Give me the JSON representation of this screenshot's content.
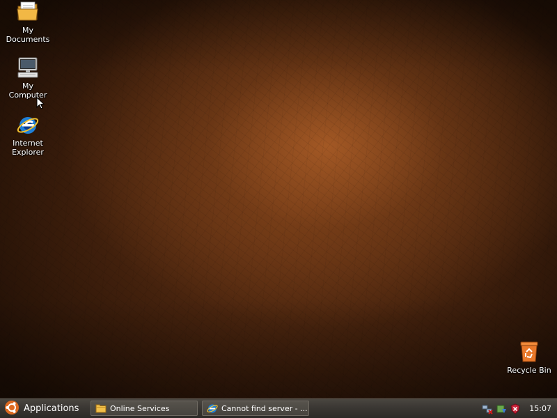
{
  "desktop": {
    "icons": [
      {
        "label_line1": "My",
        "label_line2": "Documents",
        "icon": "folder-icon"
      },
      {
        "label_line1": "My",
        "label_line2": "Computer",
        "icon": "computer-icon"
      },
      {
        "label_line1": "Internet",
        "label_line2": "Explorer",
        "icon": "internet-explorer-icon"
      },
      {
        "label_line1": "Recycle Bin",
        "label_line2": "",
        "icon": "recycle-bin-icon"
      }
    ]
  },
  "taskbar": {
    "start_label": "Applications",
    "start_icon": "ubuntu-logo-icon",
    "tasks": [
      {
        "label": "Online Services",
        "icon": "folder-icon"
      },
      {
        "label": "Cannot find server - ...",
        "icon": "internet-explorer-icon"
      }
    ],
    "tray_icons": [
      "network-disconnected-icon",
      "security-shield-icon",
      "shield-alert-icon"
    ],
    "clock": "15:07"
  },
  "colors": {
    "taskbar": "#3a3733",
    "wallpaper_highlight": "#b06028",
    "wallpaper_dark": "#1d0e05",
    "recycle_bin": "#e8782a"
  }
}
